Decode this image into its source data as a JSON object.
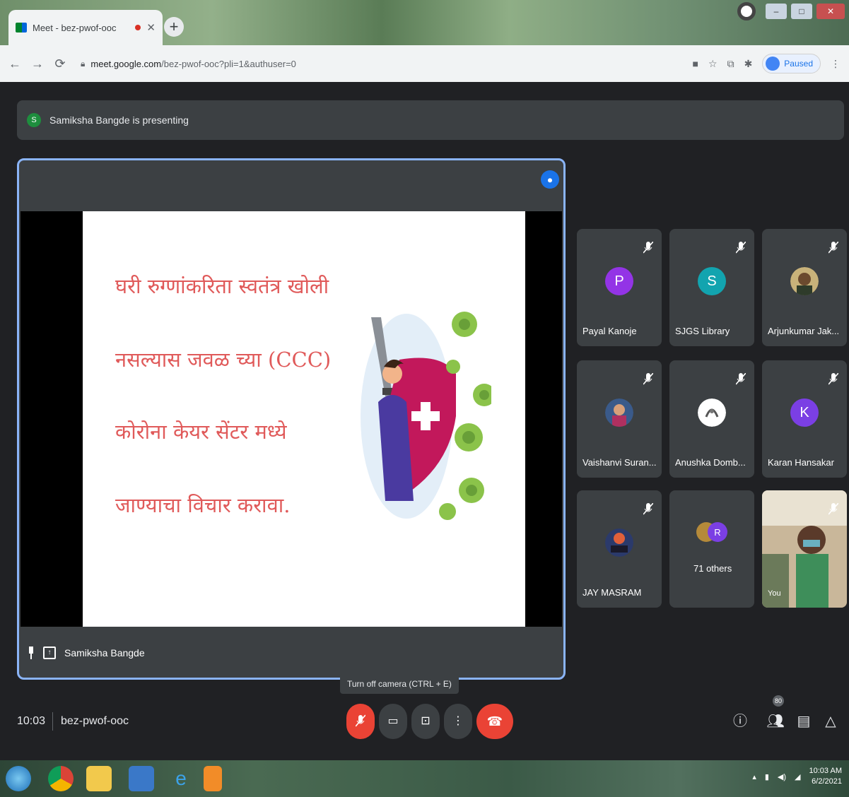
{
  "browser": {
    "tab_title": "Meet - bez-pwof-ooc",
    "new_tab": "+",
    "url_host": "meet.google.com",
    "url_path": "/bez-pwof-ooc?pli=1&authuser=0",
    "profile_label": "Paused"
  },
  "meet": {
    "presenting_banner": "Samiksha Bangde is presenting",
    "presenter_initial": "S",
    "presenter_name": "Samiksha Bangde",
    "slide_lines": [
      "घरी रुग्णांकरिता स्वतंत्र खोली",
      "नसल्यास जवळ च्या (CCC)",
      "कोरोना केयर सेंटर मध्ये",
      "जाण्याचा विचार करावा."
    ],
    "participants": [
      {
        "name": "Payal Kanoje",
        "initial": "P",
        "color": "#9334e6"
      },
      {
        "name": "SJGS Library",
        "initial": "S",
        "color": "#12a4af"
      },
      {
        "name": "Arjunkumar Jak...",
        "initial": "",
        "color": "#6b5b3e"
      },
      {
        "name": "Vaishanvi Suran...",
        "initial": "",
        "color": "#3a5a8a"
      },
      {
        "name": "Anushka Domb...",
        "initial": "",
        "color": "#ffffff"
      },
      {
        "name": "Karan Hansakar",
        "initial": "K",
        "color": "#7b3fe4"
      },
      {
        "name": "JAY MASRAM",
        "initial": "",
        "color": "#2b3a6b"
      },
      {
        "name": "71 others",
        "initial": "R",
        "color": "#7b3fe4"
      },
      {
        "name": "You",
        "initial": "",
        "color": "#8a6a4a"
      }
    ],
    "tooltip": "Turn off camera (CTRL + E)",
    "time": "10:03",
    "meeting_code": "bez-pwof-ooc",
    "people_count": "80"
  },
  "taskbar": {
    "time": "10:03 AM",
    "date": "6/2/2021"
  },
  "colors": {
    "accent_blue": "#8ab4f8",
    "danger_red": "#ea4335",
    "meet_bg": "#202124",
    "tile_bg": "#3c4043"
  }
}
